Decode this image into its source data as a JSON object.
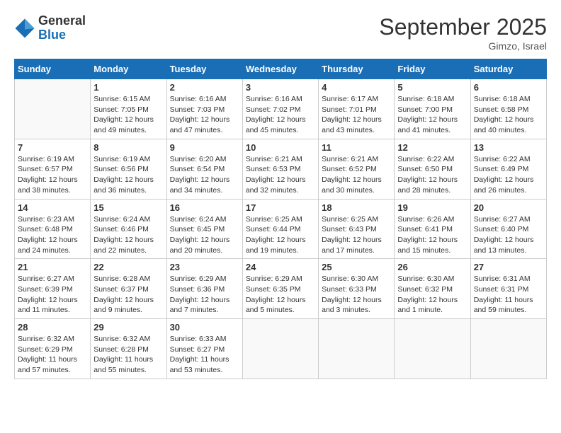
{
  "logo": {
    "general": "General",
    "blue": "Blue"
  },
  "title": {
    "month_year": "September 2025",
    "location": "Gimzo, Israel"
  },
  "days_of_week": [
    "Sunday",
    "Monday",
    "Tuesday",
    "Wednesday",
    "Thursday",
    "Friday",
    "Saturday"
  ],
  "weeks": [
    [
      {
        "day": "",
        "info": ""
      },
      {
        "day": "1",
        "info": "Sunrise: 6:15 AM\nSunset: 7:05 PM\nDaylight: 12 hours\nand 49 minutes."
      },
      {
        "day": "2",
        "info": "Sunrise: 6:16 AM\nSunset: 7:03 PM\nDaylight: 12 hours\nand 47 minutes."
      },
      {
        "day": "3",
        "info": "Sunrise: 6:16 AM\nSunset: 7:02 PM\nDaylight: 12 hours\nand 45 minutes."
      },
      {
        "day": "4",
        "info": "Sunrise: 6:17 AM\nSunset: 7:01 PM\nDaylight: 12 hours\nand 43 minutes."
      },
      {
        "day": "5",
        "info": "Sunrise: 6:18 AM\nSunset: 7:00 PM\nDaylight: 12 hours\nand 41 minutes."
      },
      {
        "day": "6",
        "info": "Sunrise: 6:18 AM\nSunset: 6:58 PM\nDaylight: 12 hours\nand 40 minutes."
      }
    ],
    [
      {
        "day": "7",
        "info": "Sunrise: 6:19 AM\nSunset: 6:57 PM\nDaylight: 12 hours\nand 38 minutes."
      },
      {
        "day": "8",
        "info": "Sunrise: 6:19 AM\nSunset: 6:56 PM\nDaylight: 12 hours\nand 36 minutes."
      },
      {
        "day": "9",
        "info": "Sunrise: 6:20 AM\nSunset: 6:54 PM\nDaylight: 12 hours\nand 34 minutes."
      },
      {
        "day": "10",
        "info": "Sunrise: 6:21 AM\nSunset: 6:53 PM\nDaylight: 12 hours\nand 32 minutes."
      },
      {
        "day": "11",
        "info": "Sunrise: 6:21 AM\nSunset: 6:52 PM\nDaylight: 12 hours\nand 30 minutes."
      },
      {
        "day": "12",
        "info": "Sunrise: 6:22 AM\nSunset: 6:50 PM\nDaylight: 12 hours\nand 28 minutes."
      },
      {
        "day": "13",
        "info": "Sunrise: 6:22 AM\nSunset: 6:49 PM\nDaylight: 12 hours\nand 26 minutes."
      }
    ],
    [
      {
        "day": "14",
        "info": "Sunrise: 6:23 AM\nSunset: 6:48 PM\nDaylight: 12 hours\nand 24 minutes."
      },
      {
        "day": "15",
        "info": "Sunrise: 6:24 AM\nSunset: 6:46 PM\nDaylight: 12 hours\nand 22 minutes."
      },
      {
        "day": "16",
        "info": "Sunrise: 6:24 AM\nSunset: 6:45 PM\nDaylight: 12 hours\nand 20 minutes."
      },
      {
        "day": "17",
        "info": "Sunrise: 6:25 AM\nSunset: 6:44 PM\nDaylight: 12 hours\nand 19 minutes."
      },
      {
        "day": "18",
        "info": "Sunrise: 6:25 AM\nSunset: 6:43 PM\nDaylight: 12 hours\nand 17 minutes."
      },
      {
        "day": "19",
        "info": "Sunrise: 6:26 AM\nSunset: 6:41 PM\nDaylight: 12 hours\nand 15 minutes."
      },
      {
        "day": "20",
        "info": "Sunrise: 6:27 AM\nSunset: 6:40 PM\nDaylight: 12 hours\nand 13 minutes."
      }
    ],
    [
      {
        "day": "21",
        "info": "Sunrise: 6:27 AM\nSunset: 6:39 PM\nDaylight: 12 hours\nand 11 minutes."
      },
      {
        "day": "22",
        "info": "Sunrise: 6:28 AM\nSunset: 6:37 PM\nDaylight: 12 hours\nand 9 minutes."
      },
      {
        "day": "23",
        "info": "Sunrise: 6:29 AM\nSunset: 6:36 PM\nDaylight: 12 hours\nand 7 minutes."
      },
      {
        "day": "24",
        "info": "Sunrise: 6:29 AM\nSunset: 6:35 PM\nDaylight: 12 hours\nand 5 minutes."
      },
      {
        "day": "25",
        "info": "Sunrise: 6:30 AM\nSunset: 6:33 PM\nDaylight: 12 hours\nand 3 minutes."
      },
      {
        "day": "26",
        "info": "Sunrise: 6:30 AM\nSunset: 6:32 PM\nDaylight: 12 hours\nand 1 minute."
      },
      {
        "day": "27",
        "info": "Sunrise: 6:31 AM\nSunset: 6:31 PM\nDaylight: 11 hours\nand 59 minutes."
      }
    ],
    [
      {
        "day": "28",
        "info": "Sunrise: 6:32 AM\nSunset: 6:29 PM\nDaylight: 11 hours\nand 57 minutes."
      },
      {
        "day": "29",
        "info": "Sunrise: 6:32 AM\nSunset: 6:28 PM\nDaylight: 11 hours\nand 55 minutes."
      },
      {
        "day": "30",
        "info": "Sunrise: 6:33 AM\nSunset: 6:27 PM\nDaylight: 11 hours\nand 53 minutes."
      },
      {
        "day": "",
        "info": ""
      },
      {
        "day": "",
        "info": ""
      },
      {
        "day": "",
        "info": ""
      },
      {
        "day": "",
        "info": ""
      }
    ]
  ]
}
